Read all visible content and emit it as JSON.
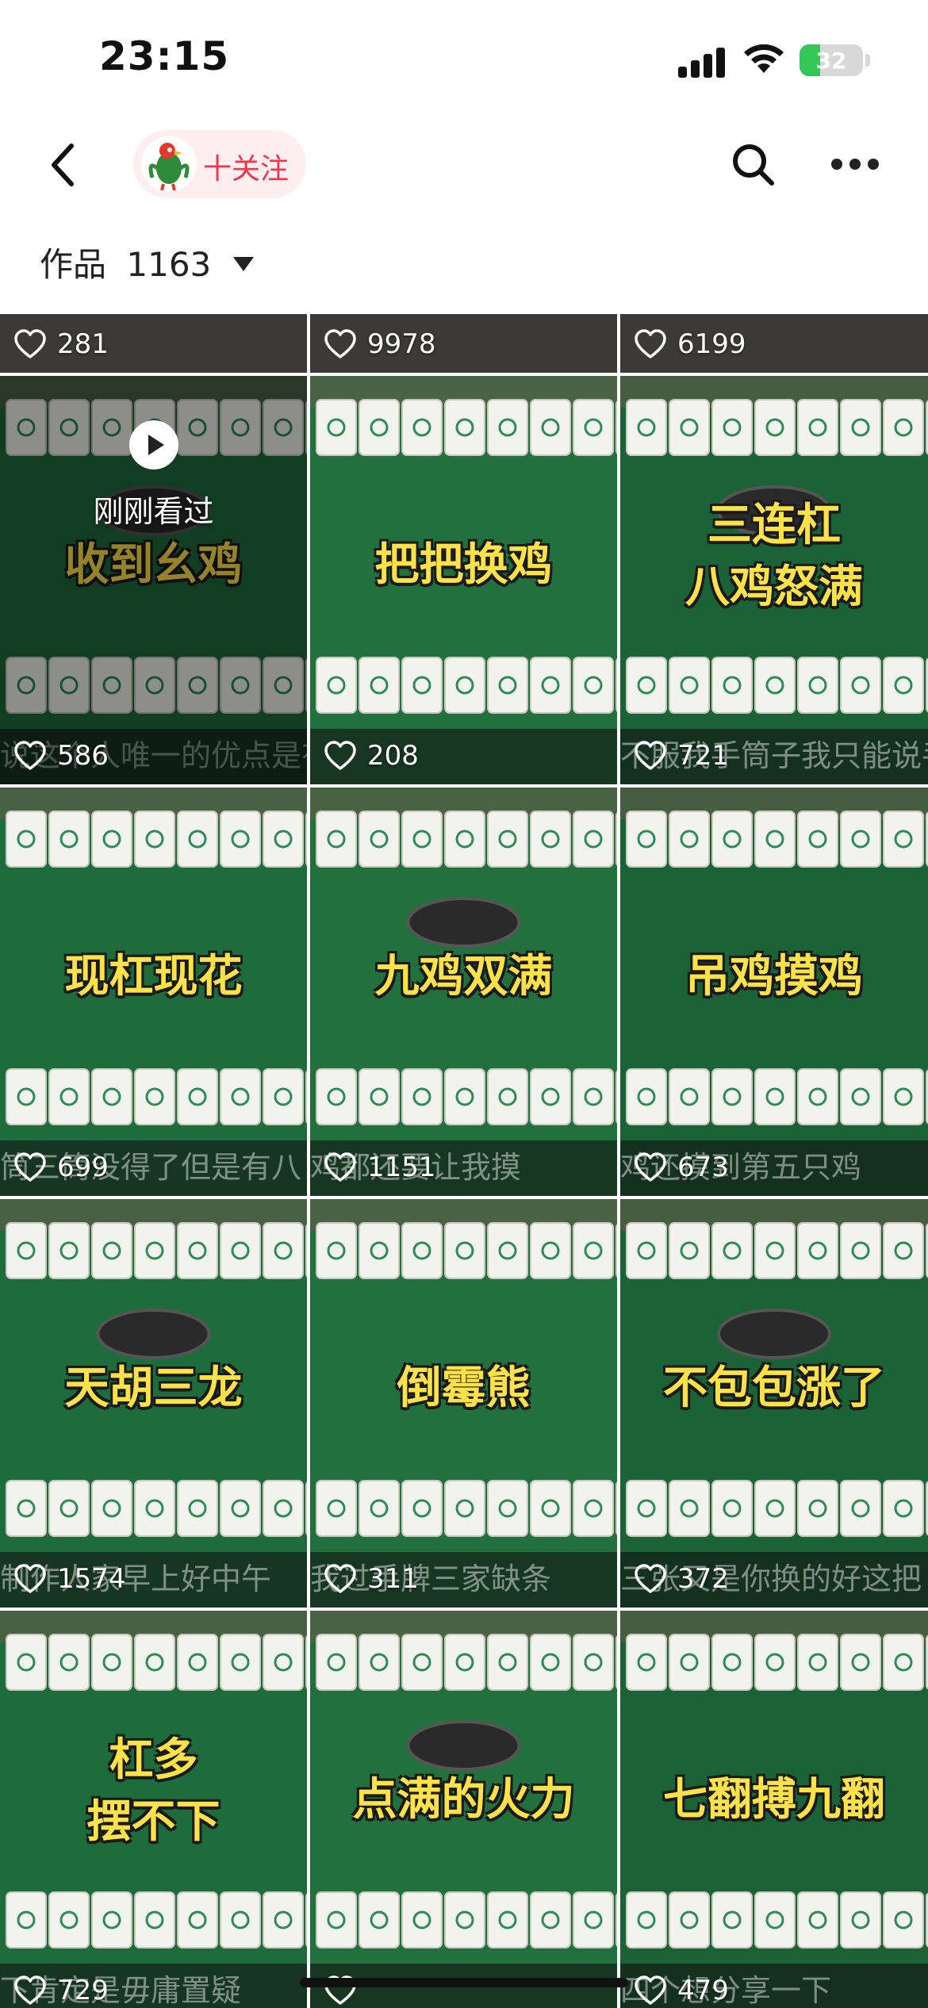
{
  "status": {
    "time": "23:15",
    "battery": "32",
    "battery_level": 0.32
  },
  "nav": {
    "follow_label": "十关注"
  },
  "works": {
    "label": "作品",
    "count": "1163"
  },
  "top_likes": [
    "281",
    "9978",
    "6199"
  ],
  "videos": [
    {
      "caption": [
        "收到幺鸡"
      ],
      "likes": "586",
      "overlay": "说这个人唯一的优点是有好处但对方子有点好但是",
      "watched": true,
      "watched_label": "刚刚看过"
    },
    {
      "caption": [
        "把把换鸡"
      ],
      "likes": "208",
      "overlay": ""
    },
    {
      "caption": [
        "三连杠",
        "八鸡怒满"
      ],
      "likes": "721",
      "overlay": "不服我手筒子我只能说手"
    },
    {
      "caption": [
        "现杠现花"
      ],
      "likes": "699",
      "overlay": "筒三筒没得了但是有八"
    },
    {
      "caption": [
        "九鸡双满"
      ],
      "likes": "1151",
      "overlay": "鸡都还要让我摸"
    },
    {
      "caption": [
        "吊鸡摸鸡"
      ],
      "likes": "673",
      "overlay": "鸡还摸到第五只鸡"
    },
    {
      "caption": [
        "天胡三龙"
      ],
      "likes": "1574",
      "overlay": "制作人家早上好中午"
    },
    {
      "caption": [
        "倒霉熊"
      ],
      "likes": "311",
      "overlay": "我过手牌三家缺条"
    },
    {
      "caption": [
        "不包包涨了"
      ],
      "likes": "372",
      "overlay": "三张又是你换的好这把"
    },
    {
      "caption": [
        "杠多",
        "摆不下"
      ],
      "likes": "729",
      "overlay": "下肯定是毋庸置疑"
    },
    {
      "caption": [
        "点满的火力"
      ],
      "likes": "",
      "overlay": ""
    },
    {
      "caption": [
        "七翻搏九翻"
      ],
      "likes": "479",
      "overlay": "四个想分享一下"
    }
  ]
}
